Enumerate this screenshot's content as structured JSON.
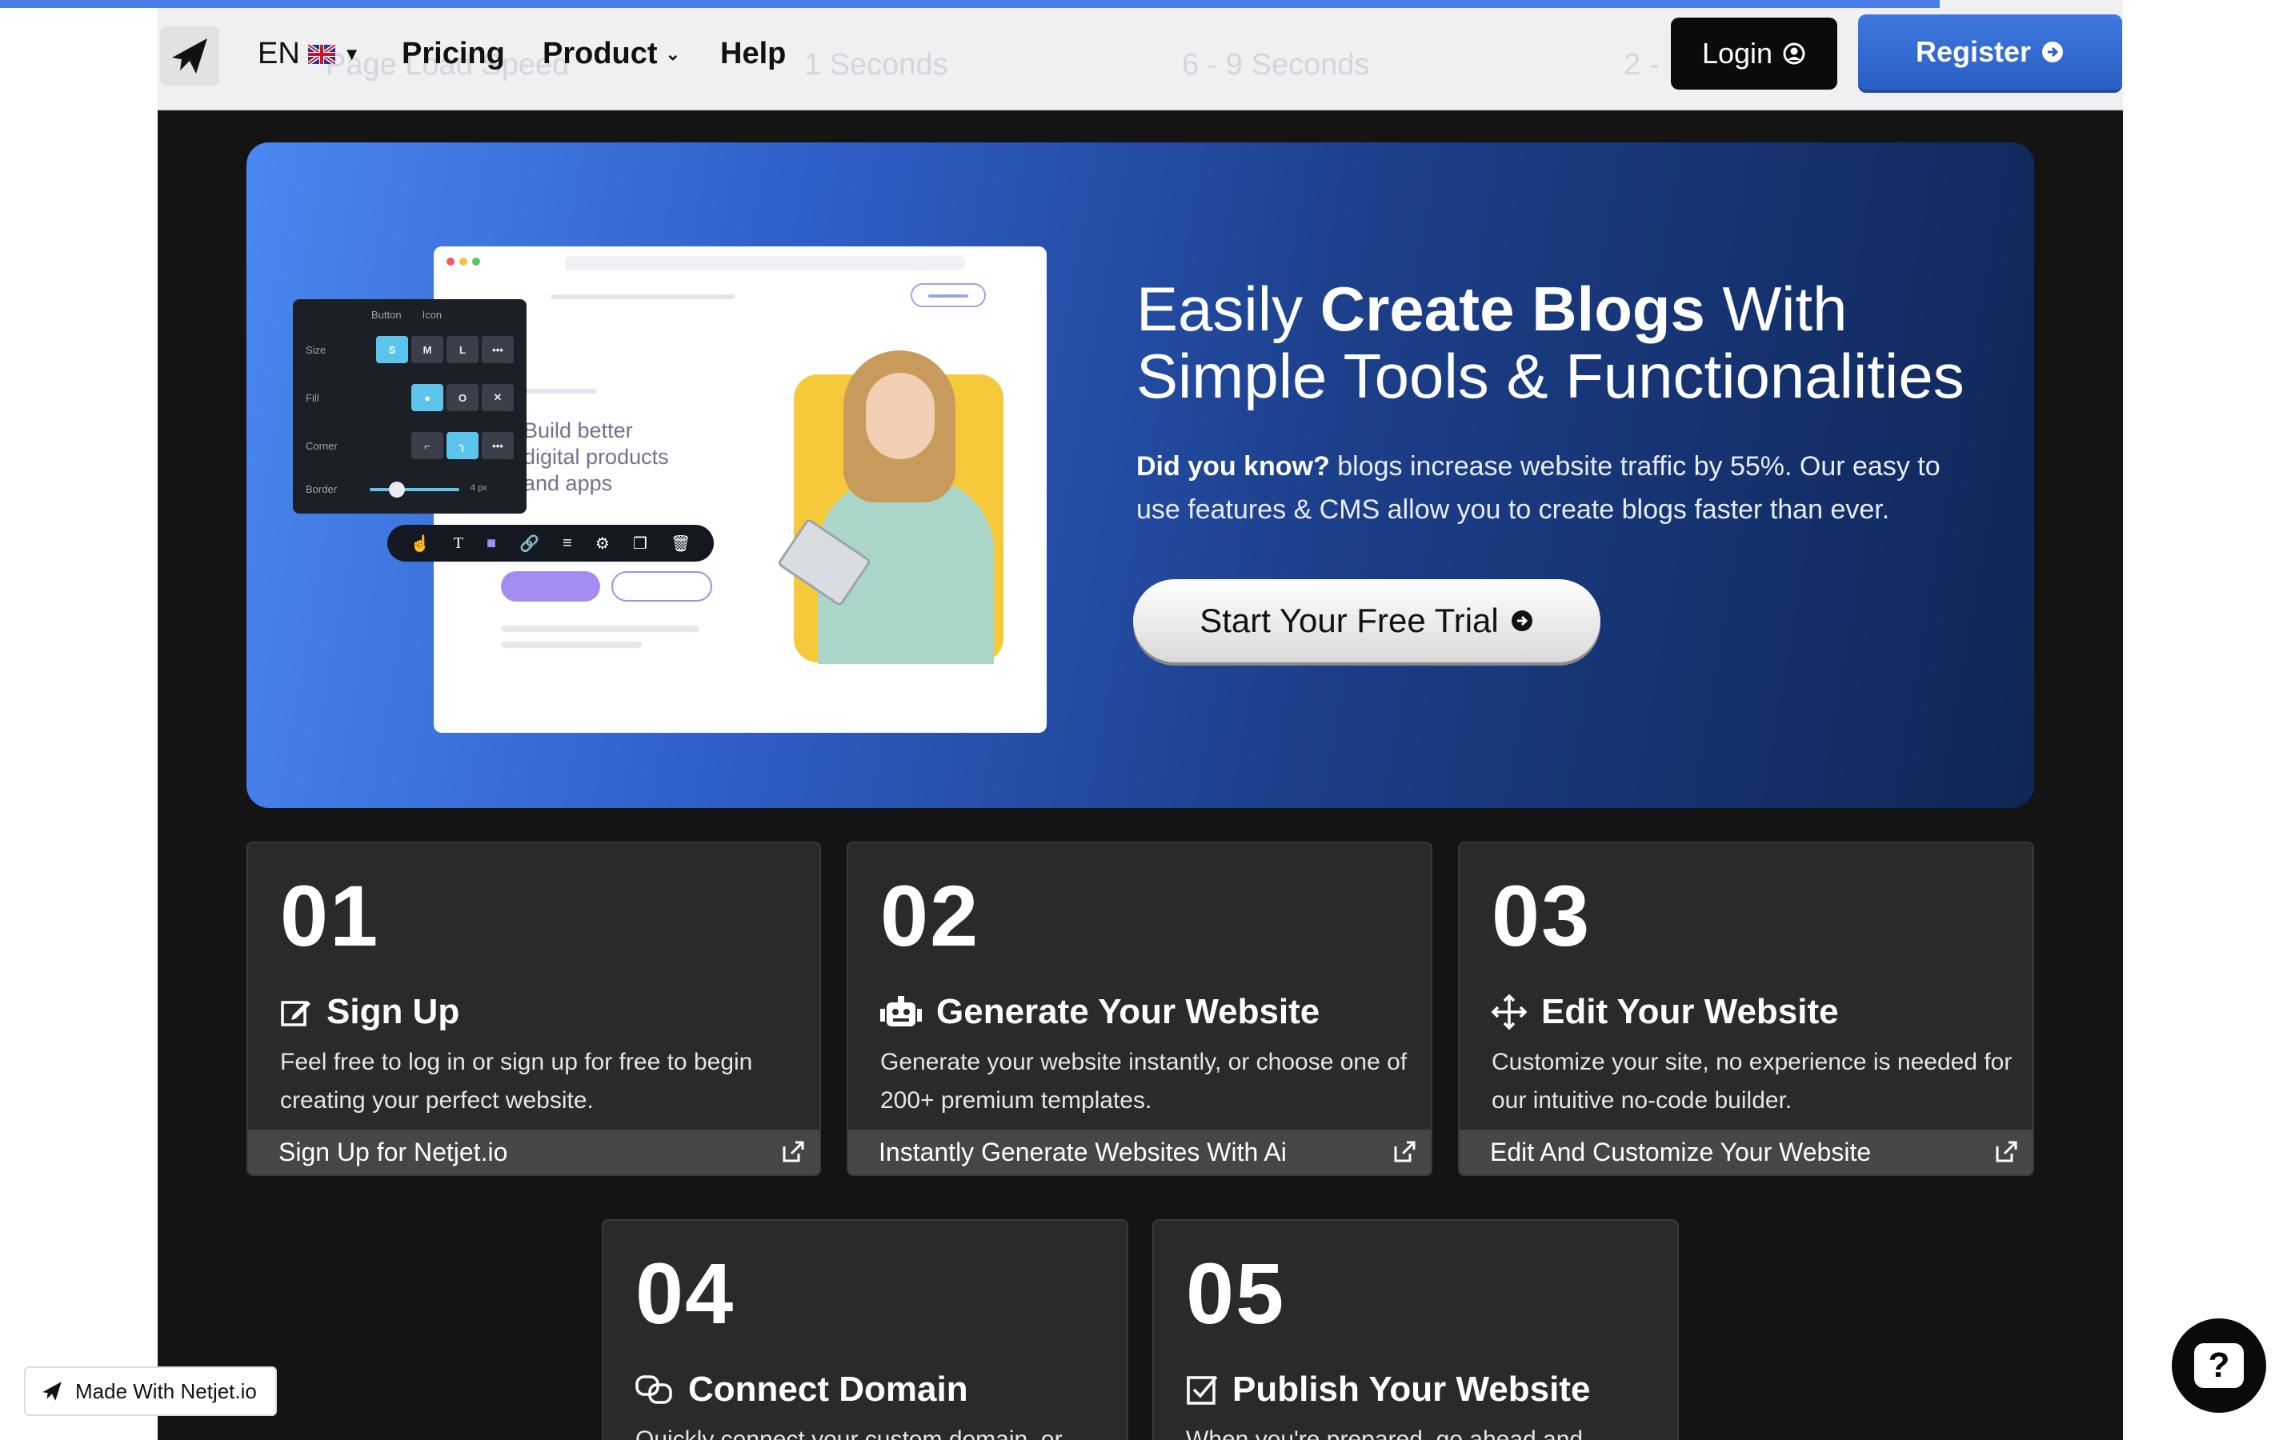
{
  "nav": {
    "lang_code": "EN",
    "pricing": "Pricing",
    "product": "Product",
    "help": "Help",
    "login": "Login",
    "register": "Register",
    "ghost_texts": [
      "Page Load Speed",
      "1 Seconds",
      "6 - 9 Seconds",
      "2 -"
    ]
  },
  "hero": {
    "title_pre": "Easily ",
    "title_bold": "Create Blogs",
    "title_post": " With",
    "title_line2": "Simple Tools & Functionalities",
    "desc_bold": "Did you know?",
    "desc_rest": " blogs increase website traffic by 55%. Our easy to use features & CMS allow you to create blogs faster than ever.",
    "cta": "Start Your Free Trial",
    "mock": {
      "text_lines": [
        "Build better",
        "digital products",
        "and apps"
      ],
      "panel_tabs": [
        "Button",
        "Icon"
      ],
      "rows": [
        {
          "label": "Size",
          "options": [
            "S",
            "M",
            "L",
            "•••"
          ]
        },
        {
          "label": "Fill",
          "options": [
            "●",
            "O",
            "✕"
          ]
        },
        {
          "label": "Corner",
          "options": [
            "⌐",
            "╮",
            "•••"
          ]
        }
      ],
      "border_label": "Border",
      "border_value": "4 px"
    }
  },
  "steps": [
    {
      "num": "01",
      "title": "Sign Up",
      "icon": "edit-icon",
      "desc": "Feel free to log in or sign up for free to begin creating your perfect website.",
      "link": "Sign Up for Netjet.io"
    },
    {
      "num": "02",
      "title": "Generate Your Website",
      "icon": "robot-icon",
      "desc": "Generate your website instantly, or choose one of 200+ premium templates.",
      "link": "Instantly Generate Websites With Ai"
    },
    {
      "num": "03",
      "title": "Edit Your Website",
      "icon": "move-icon",
      "desc": "Customize your site, no experience is needed for our intuitive no-code builder.",
      "link": "Edit And Customize Your Website"
    },
    {
      "num": "04",
      "title": "Connect Domain",
      "icon": "link-icon",
      "desc": "Quickly connect your custom domain, or",
      "link": ""
    },
    {
      "num": "05",
      "title": "Publish Your Website",
      "icon": "checkbox-icon",
      "desc": "When you're prepared, go ahead and",
      "link": ""
    }
  ],
  "badge": "Made With Netjet.io",
  "help_symbol": "?",
  "colors": {
    "accent": "#3e78de",
    "hero_start": "#4a87f0",
    "hero_end": "#0f2656",
    "card": "#2a2a2c"
  }
}
